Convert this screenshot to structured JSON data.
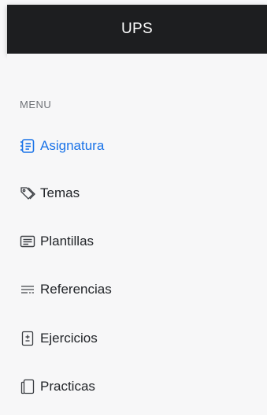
{
  "header": {
    "title": "UPS"
  },
  "sidebar": {
    "heading": "MENU",
    "accent_color": "#1a73e8",
    "items": [
      {
        "label": "Asignatura",
        "icon": "list-doc-icon",
        "active": true
      },
      {
        "label": "Temas",
        "icon": "tags-icon",
        "active": false
      },
      {
        "label": "Plantillas",
        "icon": "text-box-icon",
        "active": false
      },
      {
        "label": "Referencias",
        "icon": "text-lines-icon",
        "active": false
      },
      {
        "label": "Ejercicios",
        "icon": "plus-minus-box-icon",
        "active": false
      },
      {
        "label": "Practicas",
        "icon": "pages-icon",
        "active": false
      }
    ]
  }
}
